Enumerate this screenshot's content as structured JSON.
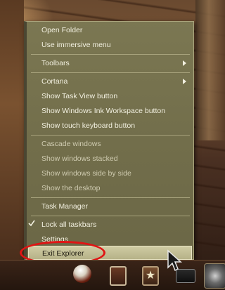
{
  "context_menu": {
    "items": [
      {
        "label": "Open Folder"
      },
      {
        "label": "Use immersive menu"
      },
      {
        "label": "Toolbars"
      },
      {
        "label": "Cortana"
      },
      {
        "label": "Show Task View button"
      },
      {
        "label": "Show Windows Ink Workspace button"
      },
      {
        "label": "Show touch keyboard button"
      },
      {
        "label": "Cascade windows"
      },
      {
        "label": "Show windows stacked"
      },
      {
        "label": "Show windows side by side"
      },
      {
        "label": "Show the desktop"
      },
      {
        "label": "Task Manager"
      },
      {
        "label": "Lock all taskbars"
      },
      {
        "label": "Settings"
      },
      {
        "label": "Exit Explorer"
      }
    ]
  },
  "annotation": {
    "color": "#e01414"
  },
  "colors": {
    "menu_background": "#726e4b",
    "menu_text": "#f2f0e0",
    "highlight": "#cfcba3"
  },
  "taskbar": {
    "icons": [
      "orb-icon",
      "picture-frame-icon",
      "star-icon",
      "monitor-icon",
      "media-icon"
    ]
  }
}
